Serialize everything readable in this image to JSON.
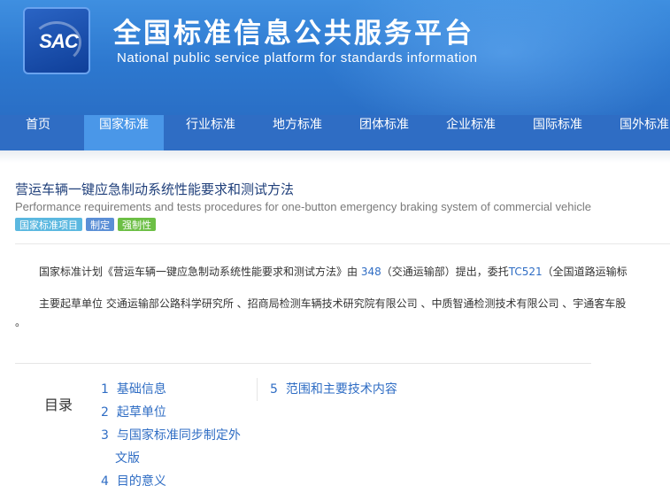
{
  "header": {
    "logo_text": "SAC",
    "title_cn": "全国标准信息公共服务平台",
    "title_en": "National public service platform  for standards information"
  },
  "nav": {
    "items": [
      {
        "label": "首页",
        "active": false
      },
      {
        "label": "国家标准",
        "active": true
      },
      {
        "label": "行业标准",
        "active": false
      },
      {
        "label": "地方标准",
        "active": false
      },
      {
        "label": "团体标准",
        "active": false
      },
      {
        "label": "企业标准",
        "active": false
      },
      {
        "label": "国际标准",
        "active": false
      },
      {
        "label": "国外标准",
        "active": false
      }
    ]
  },
  "standard": {
    "title": "营运车辆一键应急制动系统性能要求和测试方法",
    "title_en": "Performance requirements and tests procedures for one-button emergency braking system of commercial vehicle",
    "badges": [
      {
        "label": "国家标准项目",
        "color": "#5bb8e0"
      },
      {
        "label": "制定",
        "color": "#5b8fd6"
      },
      {
        "label": "强制性",
        "color": "#6cbf45"
      }
    ]
  },
  "intro": {
    "p1_prefix": "国家标准计划《营运车辆一键应急制动系统性能要求和测试方法》由 ",
    "p1_code": "348",
    "p1_mid": "（交通运输部）提出，委托",
    "p1_tc": "TC521",
    "p1_suffix": "（全国道路运输标",
    "p2": "主要起草单位 交通运输部公路科学研究所 、招商局检测车辆技术研究院有限公司 、中质智通检测技术有限公司 、宇通客车股",
    "p2_end": "。"
  },
  "toc": {
    "label": "目录",
    "col1": [
      {
        "num": "1",
        "text": "基础信息"
      },
      {
        "num": "2",
        "text": "起草单位"
      },
      {
        "num": "3",
        "text": "与国家标准同步制定外"
      },
      {
        "num": "",
        "text": "文版"
      },
      {
        "num": "4",
        "text": "目的意义"
      }
    ],
    "col2": [
      {
        "num": "5",
        "text": "范围和主要技术内容"
      }
    ]
  },
  "colors": {
    "header_bg": "#3a86da",
    "nav_bg": "#2f6dc4",
    "nav_active": "#4a97e8",
    "link": "#2f6dc4",
    "title": "#1f3f7a"
  }
}
